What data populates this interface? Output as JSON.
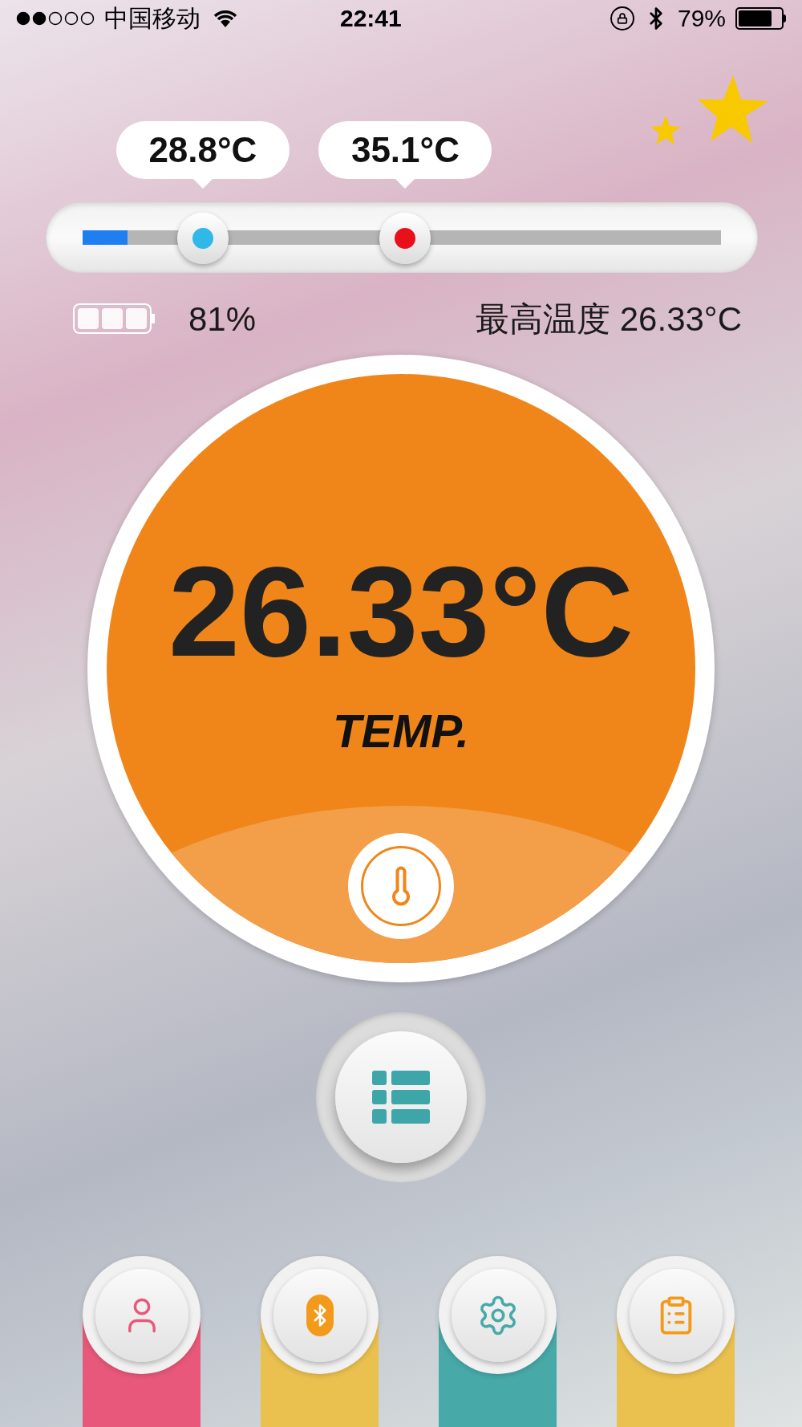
{
  "status_bar": {
    "carrier": "中国移动",
    "time": "22:41",
    "battery": "79%"
  },
  "slider": {
    "fill": {
      "level": 0.07
    },
    "thumbs": [
      {
        "reading": "28.8°C",
        "color": "#2fb8e8"
      },
      {
        "reading": "35.1°C",
        "color": "#e8101a"
      }
    ]
  },
  "device": {
    "battery": "81%",
    "max_temp": "最高温度 26.33°C"
  },
  "gauge": {
    "value": "26.33°C",
    "label": "TEMP."
  },
  "tabs": [
    {
      "kind": "person",
      "color": "#e8587a"
    },
    {
      "kind": "bluetooth",
      "color": "#eac14f"
    },
    {
      "kind": "settings",
      "color": "#47a9a8"
    },
    {
      "kind": "clipboard",
      "color": "#eac14f"
    }
  ]
}
